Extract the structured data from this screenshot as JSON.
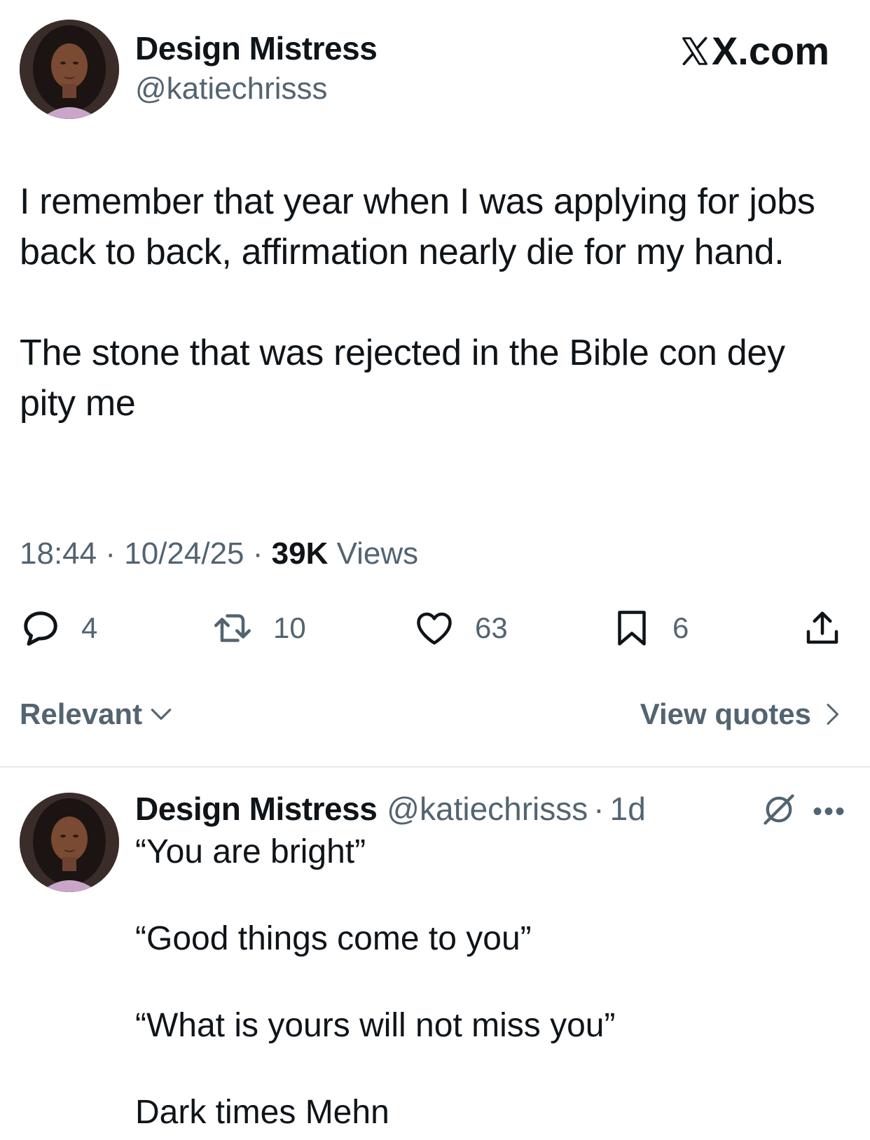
{
  "brand": "X.com",
  "tweet": {
    "author_name": "Design Mistress",
    "author_handle": "@katiechrisss",
    "paragraphs": [
      "I remember that year when I was applying for jobs back to back, affirmation nearly die for my hand.",
      "The stone that was rejected in the Bible con dey pity me"
    ],
    "time": "18:44",
    "date": "10/24/25",
    "views_count": "39K",
    "views_label": "Views"
  },
  "actions": {
    "replies": "4",
    "reposts": "10",
    "likes": "63",
    "bookmarks": "6"
  },
  "sort": {
    "label": "Relevant",
    "quotes_label": "View quotes"
  },
  "reply": {
    "author_name": "Design Mistress",
    "author_handle": "@katiechrisss",
    "age": "1d",
    "paragraphs": [
      "“You are bright”",
      "“Good things come to you”",
      "“What is yours will not miss you”",
      "Dark times Mehn"
    ]
  },
  "colors": {
    "text": "#0f1419",
    "secondary": "#536471",
    "divider": "#e6e9ec"
  }
}
